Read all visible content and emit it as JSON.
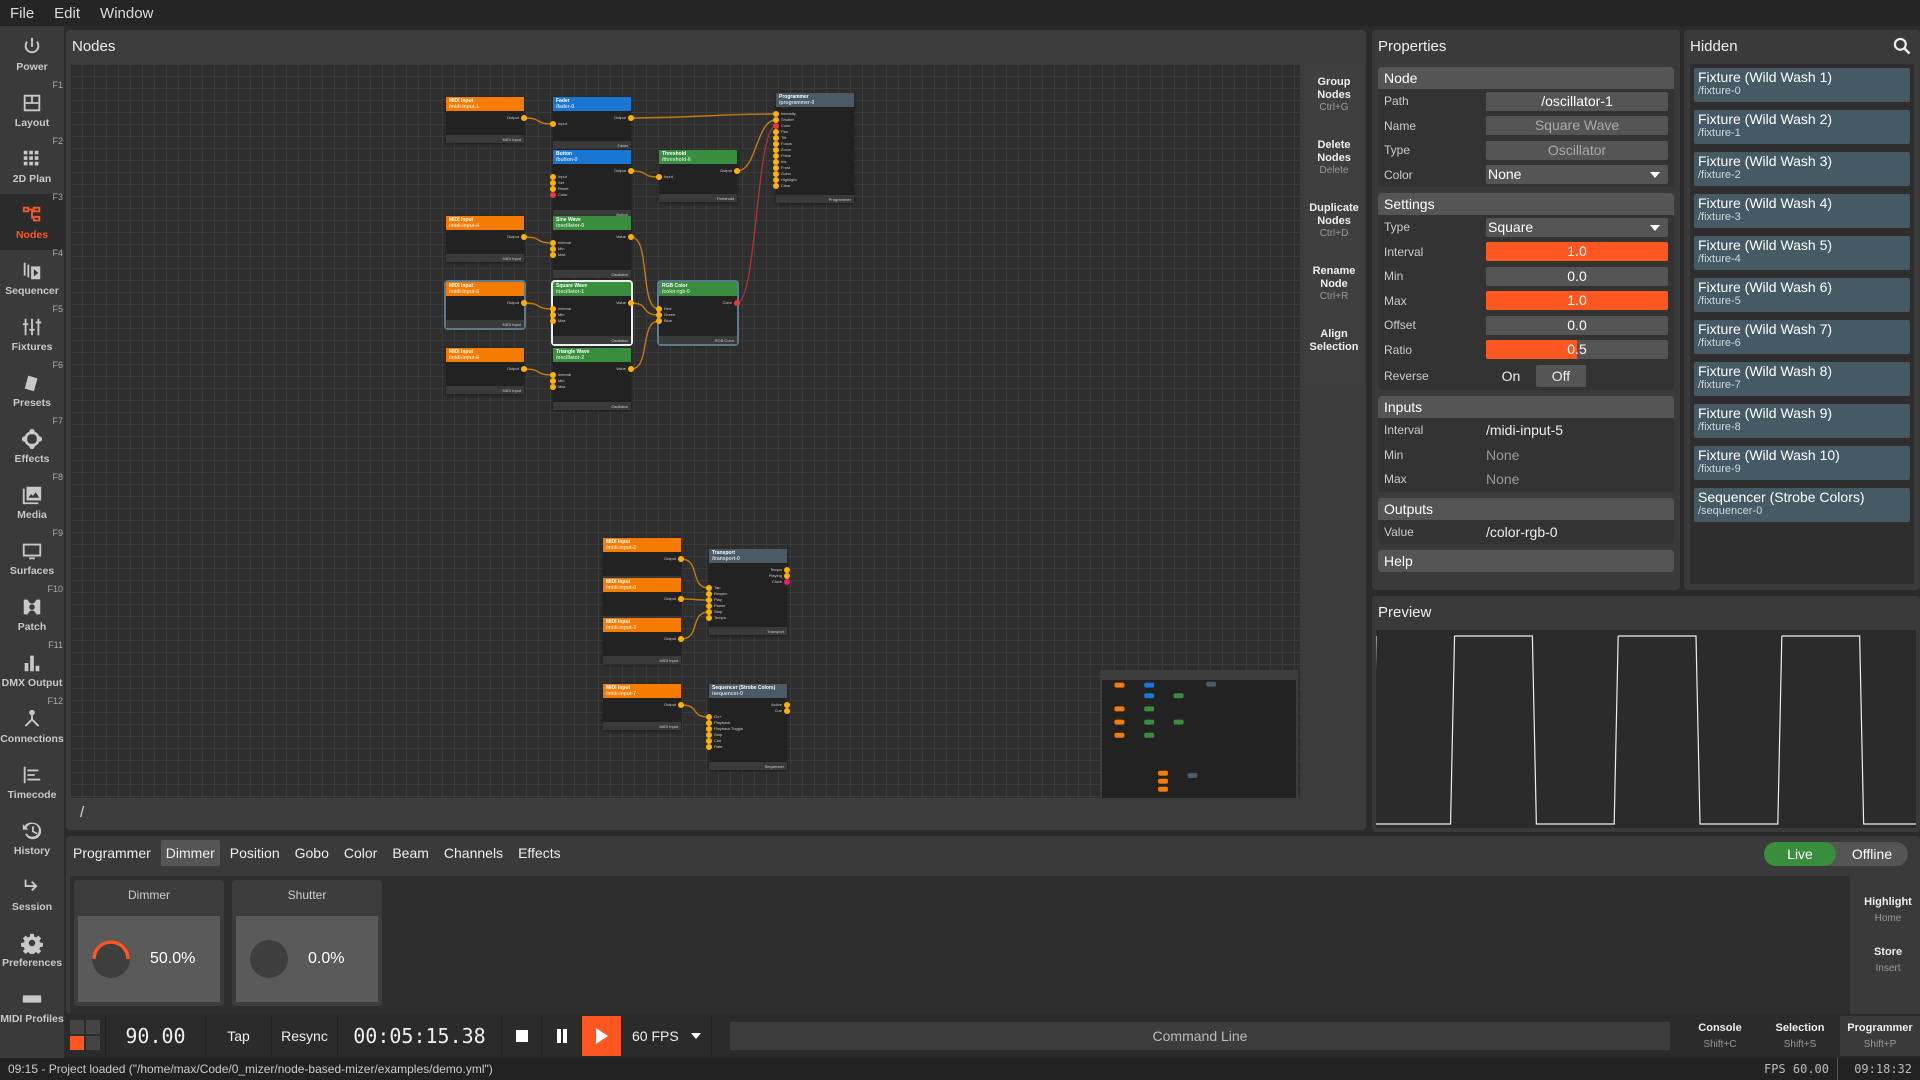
{
  "menu": [
    "File",
    "Edit",
    "Window"
  ],
  "sidebar": [
    {
      "label": "Power",
      "key": "",
      "icon": "power-icon"
    },
    {
      "label": "Layout",
      "key": "F1",
      "icon": "layout-icon"
    },
    {
      "label": "2D Plan",
      "key": "F2",
      "icon": "grid-icon"
    },
    {
      "label": "Nodes",
      "key": "F3",
      "icon": "nodes-icon",
      "active": true
    },
    {
      "label": "Sequencer",
      "key": "F4",
      "icon": "sequencer-icon"
    },
    {
      "label": "Fixtures",
      "key": "F5",
      "icon": "sliders-icon"
    },
    {
      "label": "Presets",
      "key": "F6",
      "icon": "presets-icon"
    },
    {
      "label": "Effects",
      "key": "F7",
      "icon": "effects-icon"
    },
    {
      "label": "Media",
      "key": "F8",
      "icon": "media-icon"
    },
    {
      "label": "Surfaces",
      "key": "F9",
      "icon": "monitor-icon"
    },
    {
      "label": "Patch",
      "key": "F10",
      "icon": "patch-icon"
    },
    {
      "label": "DMX Output",
      "key": "F11",
      "icon": "bar-chart-icon"
    },
    {
      "label": "Connections",
      "key": "F12",
      "icon": "connections-icon"
    },
    {
      "label": "Timecode",
      "key": "",
      "icon": "timecode-icon"
    },
    {
      "label": "History",
      "key": "",
      "icon": "history-icon"
    },
    {
      "label": "Session",
      "key": "",
      "icon": "session-icon"
    },
    {
      "label": "Preferences",
      "key": "",
      "icon": "gear-icon"
    },
    {
      "label": "MIDI Profiles",
      "key": "",
      "icon": "midi-icon"
    }
  ],
  "nodes_panel": {
    "title": "Nodes",
    "path": "/"
  },
  "node_actions": [
    {
      "label": "Group Nodes",
      "key": "Ctrl+G"
    },
    {
      "label": "Delete Nodes",
      "key": "Delete"
    },
    {
      "label": "Duplicate Nodes",
      "key": "Ctrl+D"
    },
    {
      "label": "Rename Node",
      "key": "Ctrl+R"
    },
    {
      "label": "Align Selection",
      "key": ""
    }
  ],
  "graph_nodes": [
    {
      "id": "midi1",
      "title": "MIDI Input",
      "path": "/midi-input-1",
      "type": "MIDI Input",
      "color": "orange"
    },
    {
      "id": "fader",
      "title": "Fader",
      "path": "/fader-0",
      "type": "Fader",
      "color": "blue"
    },
    {
      "id": "button",
      "title": "Button",
      "path": "/button-0",
      "type": "Button",
      "color": "blue"
    },
    {
      "id": "threshold",
      "title": "Threshold",
      "path": "/threshold-0",
      "type": "Threshold",
      "color": "green"
    },
    {
      "id": "programmer",
      "title": "Programmer",
      "path": "/programmer-0",
      "type": "Programmer",
      "color": "gray"
    },
    {
      "id": "midi4",
      "title": "MIDI Input",
      "path": "/midi-input-4",
      "type": "MIDI Input",
      "color": "orange"
    },
    {
      "id": "sine",
      "title": "Sine Wave",
      "path": "/oscillator-0",
      "type": "Oscillator",
      "color": "green"
    },
    {
      "id": "midi5",
      "title": "MIDI Input",
      "path": "/midi-input-5",
      "type": "MIDI Input",
      "color": "orange"
    },
    {
      "id": "square",
      "title": "Square Wave",
      "path": "/oscillator-1",
      "type": "Oscillator",
      "color": "green"
    },
    {
      "id": "rgb",
      "title": "RGB Color",
      "path": "/color-rgb-0",
      "type": "RGB Color",
      "color": "green"
    },
    {
      "id": "midi6",
      "title": "MIDI Input",
      "path": "/midi-input-6",
      "type": "MIDI Input",
      "color": "orange"
    },
    {
      "id": "triangle",
      "title": "Triangle Wave",
      "path": "/oscillator-2",
      "type": "Oscillator",
      "color": "green"
    },
    {
      "id": "midi2",
      "title": "MIDI Input",
      "path": "/midi-input-2",
      "type": "MIDI Input",
      "color": "orange"
    },
    {
      "id": "midi0",
      "title": "MIDI Input",
      "path": "/midi-input-0",
      "type": "MIDI Input",
      "color": "orange"
    },
    {
      "id": "midi3",
      "title": "MIDI Input",
      "path": "/midi-input-3",
      "type": "MIDI Input",
      "color": "orange"
    },
    {
      "id": "transport",
      "title": "Transport",
      "path": "/transport-0",
      "type": "Transport",
      "color": "gray"
    },
    {
      "id": "midi7",
      "title": "MIDI Input",
      "path": "/midi-input-7",
      "type": "MIDI Input",
      "color": "orange"
    },
    {
      "id": "sequencer",
      "title": "Sequencer (Strobe Colors)",
      "path": "/sequencer-0",
      "type": "Sequencer",
      "color": "gray"
    }
  ],
  "properties": {
    "title": "Properties",
    "node": {
      "header": "Node",
      "path_label": "Path",
      "path": "/oscillator-1",
      "name_label": "Name",
      "name": "Square Wave",
      "type_label": "Type",
      "type": "Oscillator",
      "color_label": "Color",
      "color": "None"
    },
    "settings": {
      "header": "Settings",
      "type_label": "Type",
      "type": "Square",
      "interval_label": "Interval",
      "interval": "1.0",
      "interval_fill": 1.0,
      "min_label": "Min",
      "min": "0.0",
      "min_fill": 0.0,
      "max_label": "Max",
      "max": "1.0",
      "max_fill": 1.0,
      "offset_label": "Offset",
      "offset": "0.0",
      "offset_fill": 0.0,
      "ratio_label": "Ratio",
      "ratio": "0.5",
      "ratio_fill": 0.5,
      "reverse_label": "Reverse",
      "on": "On",
      "off": "Off"
    },
    "inputs": {
      "header": "Inputs",
      "interval_label": "Interval",
      "interval": "/midi-input-5",
      "min_label": "Min",
      "min": "None",
      "max_label": "Max",
      "max": "None"
    },
    "outputs": {
      "header": "Outputs",
      "value_label": "Value",
      "value": "/color-rgb-0"
    },
    "help": {
      "header": "Help"
    }
  },
  "hidden": {
    "title": "Hidden",
    "items": [
      {
        "title": "Fixture (Wild Wash 1)",
        "path": "/fixture-0"
      },
      {
        "title": "Fixture (Wild Wash 2)",
        "path": "/fixture-1"
      },
      {
        "title": "Fixture (Wild Wash 3)",
        "path": "/fixture-2"
      },
      {
        "title": "Fixture (Wild Wash 4)",
        "path": "/fixture-3"
      },
      {
        "title": "Fixture (Wild Wash 5)",
        "path": "/fixture-4"
      },
      {
        "title": "Fixture (Wild Wash 6)",
        "path": "/fixture-5"
      },
      {
        "title": "Fixture (Wild Wash 7)",
        "path": "/fixture-6"
      },
      {
        "title": "Fixture (Wild Wash 8)",
        "path": "/fixture-7"
      },
      {
        "title": "Fixture (Wild Wash 9)",
        "path": "/fixture-8"
      },
      {
        "title": "Fixture (Wild Wash 10)",
        "path": "/fixture-9"
      },
      {
        "title": "Sequencer (Strobe Colors)",
        "path": "/sequencer-0"
      }
    ]
  },
  "preview": {
    "title": "Preview",
    "waveform": "square",
    "ratio": 0.5,
    "periods_visible": 3.3
  },
  "programmer": {
    "tabs": [
      "Programmer",
      "Dimmer",
      "Position",
      "Gobo",
      "Color",
      "Beam",
      "Channels",
      "Effects"
    ],
    "active_tab": "Dimmer",
    "channels": [
      {
        "label": "Dimmer",
        "value": "50.0%",
        "fraction": 0.5
      },
      {
        "label": "Shutter",
        "value": "0.0%",
        "fraction": 0.0
      }
    ],
    "live": "Live",
    "offline": "Offline",
    "side": [
      {
        "label": "Highlight",
        "key": "Home"
      },
      {
        "label": "Store",
        "key": "Insert"
      }
    ]
  },
  "transport": {
    "bpm": "90.00",
    "tap": "Tap",
    "resync": "Resync",
    "time": "00:05:15.38",
    "fps": "60 FPS",
    "command_line": "Command Line"
  },
  "views": [
    {
      "label": "Console",
      "key": "Shift+C"
    },
    {
      "label": "Selection",
      "key": "Shift+S"
    },
    {
      "label": "Programmer",
      "key": "Shift+P"
    }
  ],
  "status": {
    "message": "09:15 - Project loaded (\"/home/max/Code/0_mizer/node-based-mizer/examples/demo.yml\")",
    "fps": "FPS 60.00",
    "clock": "09:18:32"
  },
  "colors": {
    "accent": "#ff5722",
    "live": "#388e3c",
    "midi": "#f57c00",
    "blue": "#1976d2",
    "green": "#388e3c",
    "gray": "#4a5a66"
  }
}
